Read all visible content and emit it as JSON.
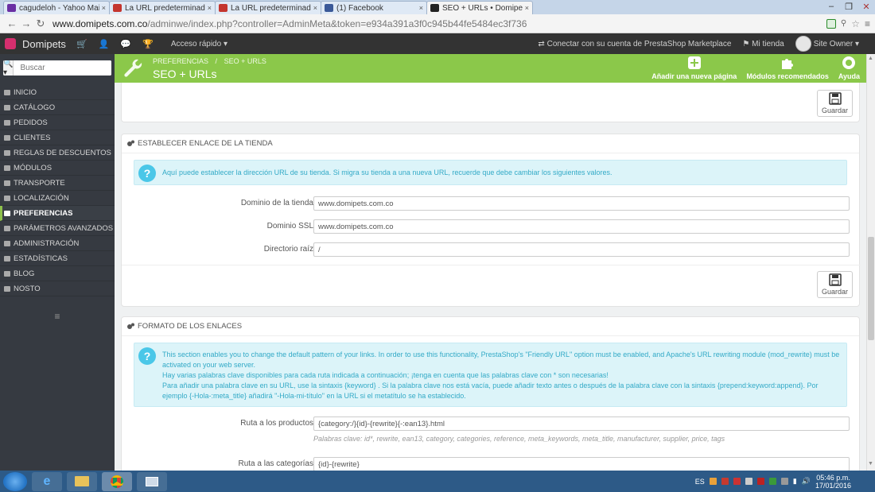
{
  "browser": {
    "tabs": [
      {
        "label": "cagudeloh - Yahoo Mail",
        "color": "#6a2fa3"
      },
      {
        "label": "La URL predeterminada es",
        "color": "#c4352e"
      },
      {
        "label": "La URL predeterminada es",
        "color": "#c4352e"
      },
      {
        "label": "(1) Facebook",
        "color": "#3b5998"
      },
      {
        "label": "SEO + URLs • Domipets",
        "color": "#222222"
      }
    ],
    "tab_close": "×",
    "url_host": "www.domipets.com.co",
    "url_path": "/adminwe/index.php?controller=AdminMeta&token=e934a391a3f0c945b44fe5484ec3f736"
  },
  "header": {
    "brand": "Domipets",
    "quick_access": "Acceso rápido ▾",
    "marketplace": "Conectar con su cuenta de PrestaShop Marketplace",
    "my_shop": "Mi tienda",
    "user": "Site Owner ▾"
  },
  "sidebar": {
    "search_placeholder": "Buscar",
    "items": [
      {
        "label": "INICIO",
        "active": false
      },
      {
        "label": "CATÁLOGO",
        "active": false
      },
      {
        "label": "PEDIDOS",
        "active": false
      },
      {
        "label": "CLIENTES",
        "active": false
      },
      {
        "label": "REGLAS DE DESCUENTOS",
        "active": false
      },
      {
        "label": "MÓDULOS",
        "active": false
      },
      {
        "label": "TRANSPORTE",
        "active": false
      },
      {
        "label": "LOCALIZACIÓN",
        "active": false
      },
      {
        "label": "PREFERENCIAS",
        "active": true
      },
      {
        "label": "PARÁMETROS AVANZADOS",
        "active": false
      },
      {
        "label": "ADMINISTRACIÓN",
        "active": false
      },
      {
        "label": "ESTADÍSTICAS",
        "active": false
      },
      {
        "label": "BLOG",
        "active": false
      },
      {
        "label": "NOSTO",
        "active": false
      }
    ]
  },
  "toolbar": {
    "breadcrumb_1": "PREFERENCIAS",
    "breadcrumb_sep": "/",
    "breadcrumb_2": "SEO + URLS",
    "title": "SEO + URLs",
    "add_page": "Añadir una nueva página",
    "modules": "Módulos recomendados",
    "help": "Ayuda"
  },
  "save_label": "Guardar",
  "shop_url_panel": {
    "title": "ESTABLECER ENLACE DE LA TIENDA",
    "info": "Aquí puede establecer la dirección URL de su tienda. Si migra su tienda a una nueva URL, recuerde que debe cambiar los siguientes valores.",
    "fields": [
      {
        "label": "Dominio de la tienda",
        "value": "www.domipets.com.co"
      },
      {
        "label": "Dominio SSL",
        "value": "www.domipets.com.co"
      },
      {
        "label": "Directorio raíz",
        "value": "/"
      }
    ]
  },
  "links_panel": {
    "title": "FORMATO DE LOS ENLACES",
    "info_1": "This section enables you to change the default pattern of your links. In order to use this functionality, PrestaShop's \"Friendly URL\" option must be enabled, and Apache's URL rewriting module (mod_rewrite) must be activated on your web server.",
    "info_2": "Hay varias palabras clave disponibles para cada ruta indicada a continuación; ¡tenga en cuenta que las palabras clave con * son necesarias!",
    "info_3": "Para añadir una palabra clave en su URL, use la sintaxis {keyword} . Si la palabra clave nos está vacía, puede añadir texto antes o después de la palabra clave con la sintaxis {prepend:keyword:append}. Por ejemplo {-Hola-:meta_title} añadirá \"-Hola-mi-título\" en la URL si el metatítulo se ha establecido.",
    "fields": [
      {
        "label": "Ruta a los productos",
        "value": "{category:/}{id}-{rewrite}{-:ean13}.html",
        "help": "Palabras clave: id*, rewrite, ean13, category, categories, reference, meta_keywords, meta_title, manufacturer, supplier, price, tags"
      },
      {
        "label": "Ruta a las categorías",
        "value": "{id}-{rewrite}"
      }
    ]
  },
  "taskbar": {
    "lang": "ES",
    "time": "05:46 p.m.",
    "date": "17/01/2016"
  }
}
